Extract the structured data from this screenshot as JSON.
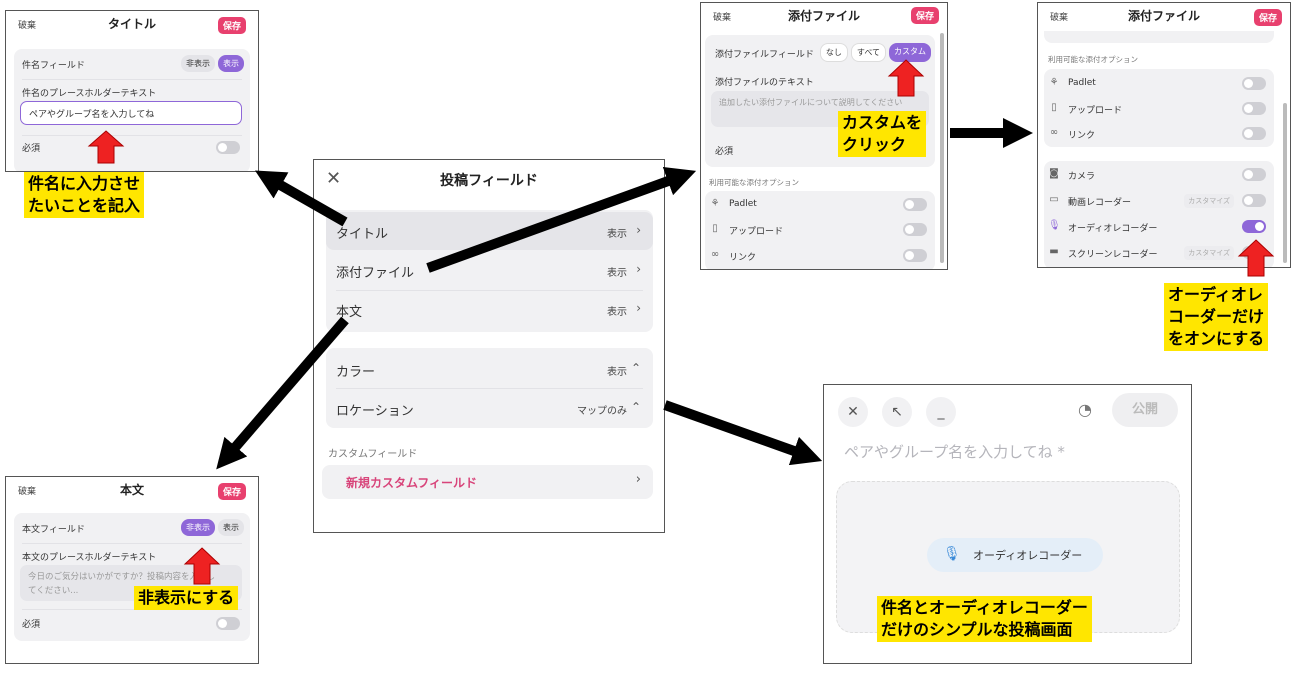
{
  "common": {
    "discard": "破棄",
    "save": "保存"
  },
  "title_panel": {
    "title": "タイトル",
    "field_label": "件名フィールド",
    "hide": "非表示",
    "show": "表示",
    "placeholder_label": "件名のプレースホルダーテキスト",
    "placeholder_value": "ペアやグループ名を入力してね",
    "required": "必須",
    "callout": [
      "件名に入力させ",
      "たいことを記入"
    ]
  },
  "body_panel": {
    "title": "本文",
    "field_label": "本文フィールド",
    "hide": "非表示",
    "show": "表示",
    "placeholder_label": "本文のプレースホルダーテキスト",
    "placeholder_value": [
      "今日のご気分はいかがですか？投稿内容を入力し",
      "てください..."
    ],
    "required": "必須",
    "callout": "非表示にする"
  },
  "attach_panel": {
    "title": "添付ファイル",
    "field_label": "添付ファイルフィールド",
    "options": [
      "なし",
      "すべて",
      "カスタム"
    ],
    "text_label": "添付ファイルのテキスト",
    "text_placeholder": "追加したい添付ファイルについて説明してください",
    "required": "必須",
    "available_label": "利用可能な添付オプション",
    "items": [
      "Padlet",
      "アップロード",
      "リンク"
    ],
    "callout": [
      "カスタムを",
      "クリック"
    ]
  },
  "attach_panel2": {
    "title": "添付ファイル",
    "available_label": "利用可能な添付オプション",
    "group1": [
      "Padlet",
      "アップロード",
      "リンク"
    ],
    "group2": [
      {
        "label": "カメラ",
        "custom": ""
      },
      {
        "label": "動画レコーダー",
        "custom": "カスタマイズ"
      },
      {
        "label": "オーディオレコーダー",
        "custom": "",
        "on": true
      },
      {
        "label": "スクリーンレコーダー",
        "custom": "カスタマイズ"
      }
    ],
    "callout": [
      "オーディオレ",
      "コーダーだけ",
      "をオンにする"
    ]
  },
  "main_panel": {
    "title": "投稿フィールド",
    "rows1": [
      {
        "label": "タイトル",
        "value": "表示"
      },
      {
        "label": "添付ファイル",
        "value": "表示"
      },
      {
        "label": "本文",
        "value": "表示"
      }
    ],
    "rows2": [
      {
        "label": "カラー",
        "value": "表示"
      },
      {
        "label": "ロケーション",
        "value": "マップのみ"
      }
    ],
    "custom_section": "カスタムフィールド",
    "new_custom": "新規カスタムフィールド"
  },
  "preview_panel": {
    "publish": "公開",
    "title_placeholder": "ペアやグループ名を入力してね *",
    "audio_button": "オーディオレコーダー",
    "callout": [
      "件名とオーディオレコーダー",
      "だけのシンプルな投稿画面"
    ]
  },
  "colors": {
    "accent": "#8e67d8",
    "save": "#e8406e",
    "callout": "#ffe600",
    "pink_text": "#d8447a",
    "arrow": "#000000",
    "red_arrow": "#ee2222"
  }
}
